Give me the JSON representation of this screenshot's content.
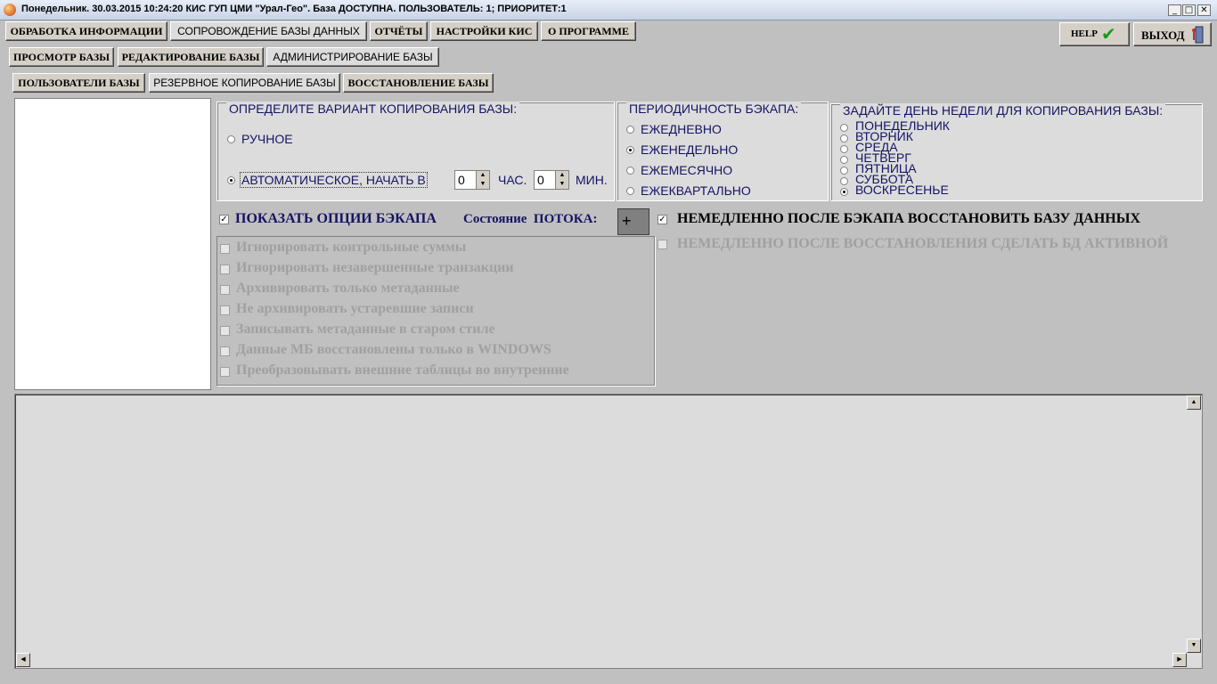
{
  "window": {
    "title": "Понедельник. 30.03.2015 10:24:20 КИС ГУП ЦМИ \"Урал-Гео\". База ДОСТУПНА. ПОЛЬЗОВАТЕЛЬ: 1; ПРИОРИТЕТ:1",
    "minimize": "_",
    "maximize": "□",
    "close": "✕"
  },
  "menu": {
    "tabs": [
      "ОБРАБОТКА ИНФОРМАЦИИ",
      "СОПРОВОЖДЕНИЕ БАЗЫ ДАННЫХ",
      "ОТЧЁТЫ",
      "НАСТРОЙКИ КИС",
      "О ПРОГРАММЕ"
    ],
    "active": 1,
    "help_label": "HELP",
    "exit_label": "ВЫХОД"
  },
  "subtabs": {
    "items": [
      "ПРОСМОТР БАЗЫ",
      "РЕДАКТИРОВАНИЕ БАЗЫ",
      "АДМИНИСТРИРОВАНИЕ БАЗЫ"
    ],
    "active": 2
  },
  "admin_tabs": {
    "items": [
      "ПОЛЬЗОВАТЕЛИ БАЗЫ",
      "РЕЗЕРВНОЕ КОПИРОВАНИЕ БАЗЫ",
      "ВОССТАНОВЛЕНИЕ БАЗЫ"
    ],
    "active": 1
  },
  "copy_variant": {
    "title": "ОПРЕДЕЛИТЕ ВАРИАНТ КОПИРОВАНИЯ БАЗЫ:",
    "manual": "РУЧНОЕ",
    "auto": "АВТОМАТИЧЕСКОЕ, НАЧАТЬ В",
    "hour_value": "0",
    "hour_unit": "ЧАС.",
    "min_value": "0",
    "min_unit": "МИН.",
    "selected": "auto"
  },
  "periodicity": {
    "title": "ПЕРИОДИЧНОСТЬ БЭКАПА:",
    "options": [
      "ЕЖЕДНЕВНО",
      "ЕЖЕНЕДЕЛЬНО",
      "ЕЖЕМЕСЯЧНО",
      "ЕЖЕКВАРТАЛЬНО"
    ],
    "selected": 1
  },
  "weekday": {
    "title": "ЗАДАЙТЕ ДЕНЬ НЕДЕЛИ ДЛЯ КОПИРОВАНИЯ БАЗЫ:",
    "options": [
      "ПОНЕДЕЛЬНИК",
      "ВТОРНИК",
      "СРЕДА",
      "ЧЕТВЕРГ",
      "ПЯТНИЦА",
      "СУББОТА",
      "ВОСКРЕСЕНЬЕ"
    ],
    "selected": 6
  },
  "backup_options": {
    "show_label": "ПОКАЗАТЬ ОПЦИИ БЭКАПА",
    "show_checked": true,
    "state_label": "Состояние  ПОТОКА:",
    "state_value": "+",
    "items": [
      "Игнорировать контрольные суммы",
      "Игнорировать незавершенные транзакции",
      "Архивировать только метаданные",
      "Не архивировать устаревшие записи",
      "Записывать метаданные в старом стиле",
      "Данные МБ восстановлены только в WINDOWS",
      "Преобразовывать внешние таблицы во внутренние"
    ]
  },
  "restore_options": {
    "restore_after": "НЕМЕДЛЕННО ПОСЛЕ БЭКАПА ВОССТАНОВИТЬ БАЗУ ДАННЫХ",
    "restore_after_checked": true,
    "activate_after": "НЕМЕДЛЕННО ПОСЛЕ ВОССТАНОВЛЕНИЯ СДЕЛАТЬ БД АКТИВНОЙ",
    "activate_after_checked": false
  },
  "colors": {
    "label_blue": "#141464",
    "disabled_gray": "#a0a0a0",
    "help_check_green": "#1a9a1a"
  }
}
